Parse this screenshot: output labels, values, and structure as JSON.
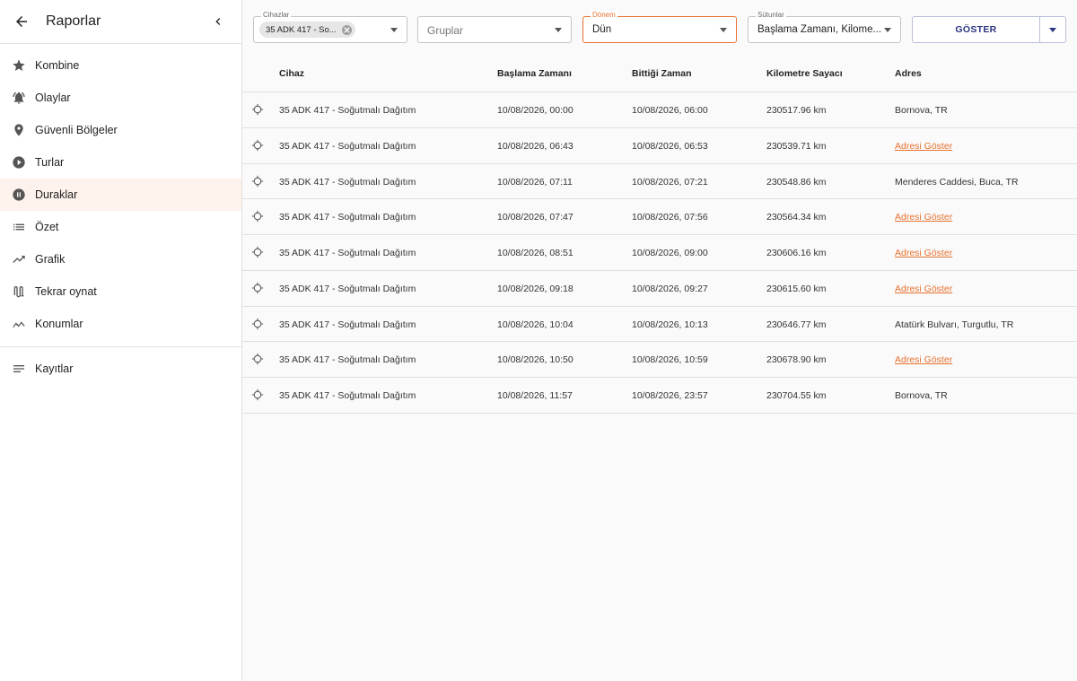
{
  "sidebar": {
    "title": "Raporlar",
    "items": [
      {
        "label": "Kombine",
        "icon": "star-icon"
      },
      {
        "label": "Olaylar",
        "icon": "bell-icon"
      },
      {
        "label": "Güvenli Bölgeler",
        "icon": "map-pin-icon"
      },
      {
        "label": "Turlar",
        "icon": "play-circle-icon"
      },
      {
        "label": "Duraklar",
        "icon": "pause-circle-icon"
      },
      {
        "label": "Özet",
        "icon": "list-icon"
      },
      {
        "label": "Grafik",
        "icon": "trending-up-icon"
      },
      {
        "label": "Tekrar oynat",
        "icon": "route-icon"
      },
      {
        "label": "Konumlar",
        "icon": "timeline-icon"
      }
    ],
    "extra_items": [
      {
        "label": "Kayıtlar",
        "icon": "notes-icon"
      }
    ],
    "active_item": "Duraklar"
  },
  "filters": {
    "devices": {
      "label": "Cihazlar",
      "chip": "35 ADK 417 - So..."
    },
    "groups": {
      "placeholder": "Gruplar"
    },
    "period": {
      "label": "Dönem",
      "value": "Dün"
    },
    "columns": {
      "label": "Sütunlar",
      "value": "Başlama Zamanı, Kilome..."
    },
    "show_button": "GÖSTER"
  },
  "colors": {
    "accent": "#e8712f",
    "button_text": "#2c3580"
  },
  "table": {
    "headers": {
      "device": "Cihaz",
      "start": "Başlama Zamanı",
      "end": "Bittiği Zaman",
      "odometer": "Kilometre Sayacı",
      "address": "Adres"
    },
    "rows": [
      {
        "device": "35 ADK 417 - Soğutmalı Dağıtım",
        "start": "10/08/2026, 00:00",
        "end": "10/08/2026, 06:00",
        "odometer": "230517.96 km",
        "address": "Bornova, TR",
        "address_is_link": false
      },
      {
        "device": "35 ADK 417 - Soğutmalı Dağıtım",
        "start": "10/08/2026, 06:43",
        "end": "10/08/2026, 06:53",
        "odometer": "230539.71 km",
        "address": "Adresi Göster",
        "address_is_link": true
      },
      {
        "device": "35 ADK 417 - Soğutmalı Dağıtım",
        "start": "10/08/2026, 07:11",
        "end": "10/08/2026, 07:21",
        "odometer": "230548.86 km",
        "address": "Menderes Caddesi, Buca, TR",
        "address_is_link": false
      },
      {
        "device": "35 ADK 417 - Soğutmalı Dağıtım",
        "start": "10/08/2026, 07:47",
        "end": "10/08/2026, 07:56",
        "odometer": "230564.34 km",
        "address": "Adresi Göster",
        "address_is_link": true
      },
      {
        "device": "35 ADK 417 - Soğutmalı Dağıtım",
        "start": "10/08/2026, 08:51",
        "end": "10/08/2026, 09:00",
        "odometer": "230606.16 km",
        "address": "Adresi Göster",
        "address_is_link": true
      },
      {
        "device": "35 ADK 417 - Soğutmalı Dağıtım",
        "start": "10/08/2026, 09:18",
        "end": "10/08/2026, 09:27",
        "odometer": "230615.60 km",
        "address": "Adresi Göster",
        "address_is_link": true
      },
      {
        "device": "35 ADK 417 - Soğutmalı Dağıtım",
        "start": "10/08/2026, 10:04",
        "end": "10/08/2026, 10:13",
        "odometer": "230646.77 km",
        "address": "Atatürk Bulvarı, Turgutlu, TR",
        "address_is_link": false
      },
      {
        "device": "35 ADK 417 - Soğutmalı Dağıtım",
        "start": "10/08/2026, 10:50",
        "end": "10/08/2026, 10:59",
        "odometer": "230678.90 km",
        "address": "Adresi Göster",
        "address_is_link": true
      },
      {
        "device": "35 ADK 417 - Soğutmalı Dağıtım",
        "start": "10/08/2026, 11:57",
        "end": "10/08/2026, 23:57",
        "odometer": "230704.55 km",
        "address": "Bornova, TR",
        "address_is_link": false
      }
    ]
  }
}
